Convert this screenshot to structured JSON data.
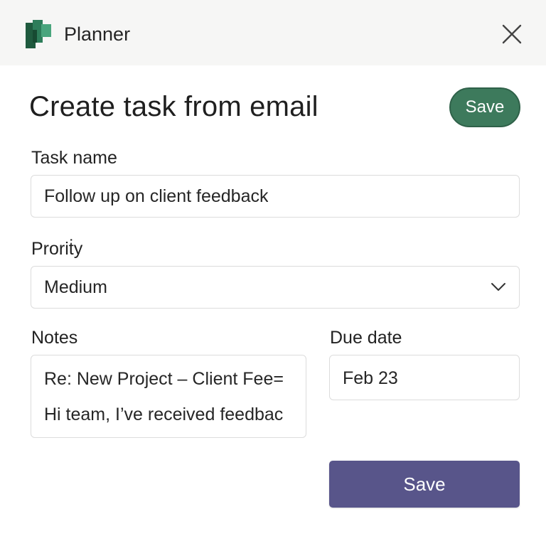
{
  "header": {
    "app_name": "Planner",
    "logo_icon": "planner-logo-icon",
    "close_icon": "close-icon"
  },
  "form": {
    "title": "Create task from email",
    "header_save_label": "Save",
    "task_name_label": "Task name",
    "task_name_value": "Follow up on client feedback",
    "priority_label": "Proriṫy",
    "priority_value": "Medium",
    "notes_label": "Notes",
    "notes_lines": [
      "Re: New Project – Client Fee=",
      "Hi team, I’ve received feedbac"
    ],
    "due_date_label": "Due date",
    "due_date_value": "Feb 23",
    "primary_save_label": "Save"
  },
  "colors": {
    "header_bg": "#f6f6f5",
    "pill_save_bg": "#3d7a5c",
    "primary_save_bg": "#58558a",
    "logo_dark": "#1f5a3e",
    "logo_mid": "#2e7d5a",
    "logo_light": "#49a57d"
  }
}
